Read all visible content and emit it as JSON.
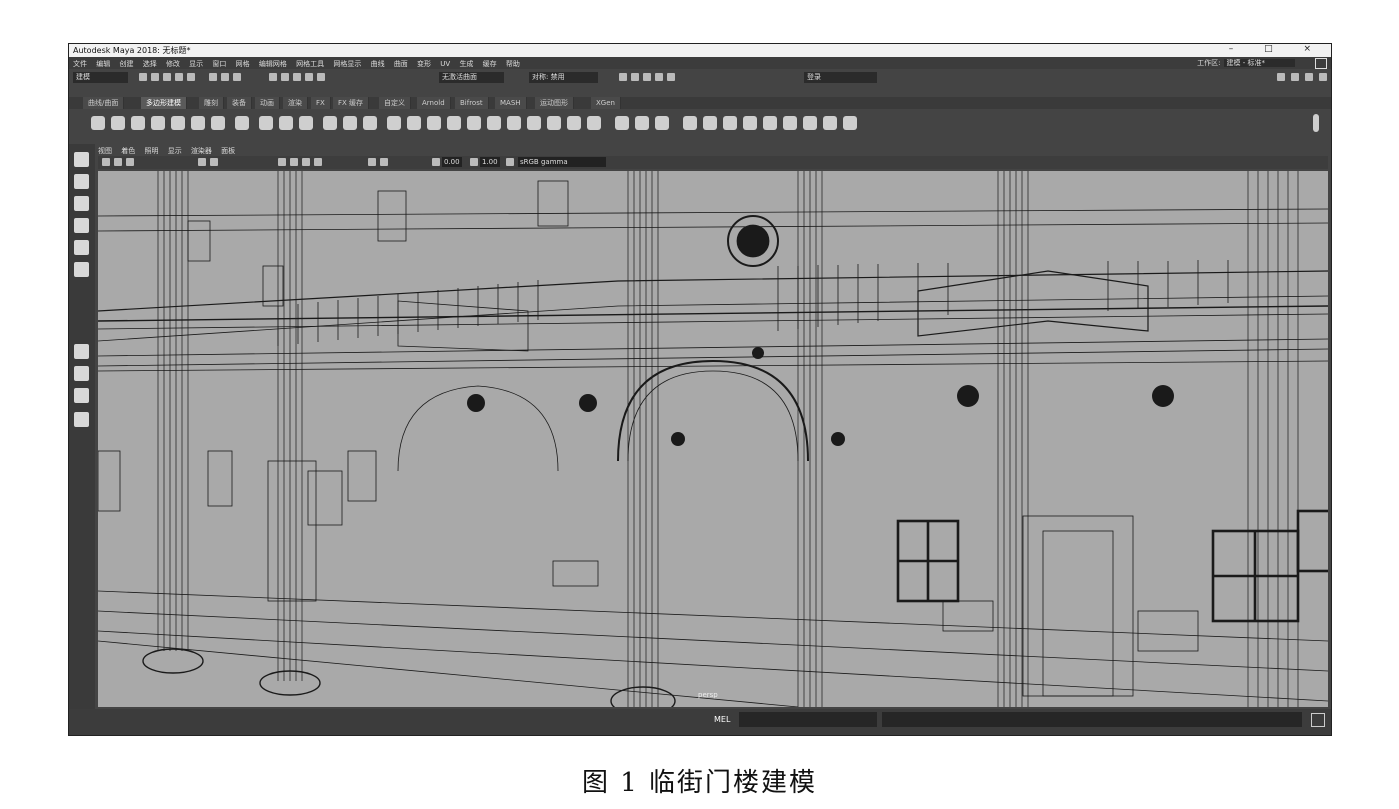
{
  "window": {
    "title": "Autodesk Maya 2018: 无标题*",
    "controls": [
      "–",
      "□",
      "×"
    ]
  },
  "menubar": {
    "items": [
      "文件",
      "编辑",
      "创建",
      "选择",
      "修改",
      "显示",
      "窗口",
      "网格",
      "编辑网格",
      "网格工具",
      "网格显示",
      "曲线",
      "曲面",
      "变形",
      "UV",
      "生成",
      "缓存",
      "帮助"
    ],
    "workspace_label": "工作区:",
    "workspace_value": "建模 - 标准*"
  },
  "statusline": {
    "mode_value": "建模",
    "live_surface": "无激活曲面",
    "symmetry": "对称: 禁用",
    "login": "登录"
  },
  "shelf": {
    "tabs": [
      "曲线/曲面",
      "多边形建模",
      "雕刻",
      "装备",
      "动画",
      "渲染",
      "FX",
      "FX 缓存",
      "自定义",
      "Arnold",
      "Bifrost",
      "MASH",
      "运动图形",
      "XGen"
    ],
    "active_tab": 1
  },
  "viewport": {
    "menu": [
      "视图",
      "着色",
      "照明",
      "显示",
      "渲染器",
      "面板"
    ],
    "exposure": "0.00",
    "gamma": "1.00",
    "colorspace": "sRGB gamma",
    "camera_label": "persp"
  },
  "cmdline": {
    "mel_label": "MEL"
  },
  "caption": "图 1   临街门楼建模",
  "colors": {
    "viewport_bg": "#a9a9a9",
    "ui_dark": "#444444",
    "wire": "#1a1a1a"
  }
}
